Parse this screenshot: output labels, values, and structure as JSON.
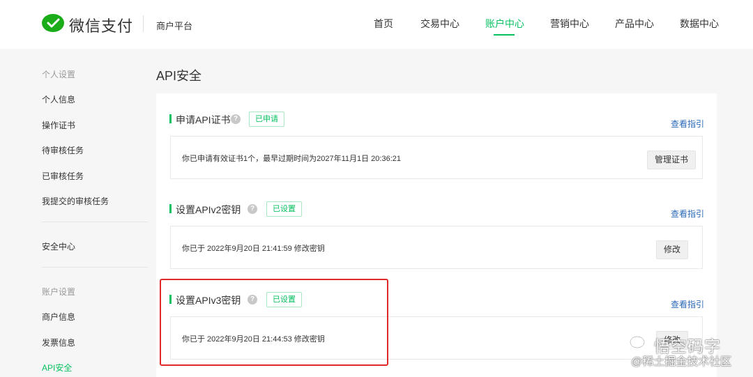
{
  "header": {
    "brand": "微信支付",
    "platform": "商户平台",
    "nav": [
      {
        "label": "首页"
      },
      {
        "label": "交易中心"
      },
      {
        "label": "账户中心"
      },
      {
        "label": "营销中心"
      },
      {
        "label": "产品中心"
      },
      {
        "label": "数据中心"
      }
    ],
    "active_nav": "账户中心",
    "accent_color": "#07c160"
  },
  "sidebar": {
    "group1_title": "个人设置",
    "group1_items": [
      {
        "label": "个人信息"
      },
      {
        "label": "操作证书"
      },
      {
        "label": "待审核任务"
      },
      {
        "label": "已审核任务"
      },
      {
        "label": "我提交的审核任务"
      }
    ],
    "security_center": "安全中心",
    "group2_title": "账户设置",
    "group2_items": [
      {
        "label": "商户信息"
      },
      {
        "label": "发票信息"
      },
      {
        "label": "API安全"
      }
    ],
    "active_item": "API安全"
  },
  "main": {
    "title": "API安全",
    "sections": [
      {
        "title": "申请API证书",
        "badge": "已申请",
        "guide": "查看指引",
        "info": "你已申请有效证书1个，最早过期时间为2027年11月1日 20:36:21",
        "button": "管理证书"
      },
      {
        "title": "设置APIv2密钥",
        "badge": "已设置",
        "guide": "查看指引",
        "info": "你已于 2022年9月20日 21:41:59 修改密钥",
        "button": "修改"
      },
      {
        "title": "设置APIv3密钥",
        "badge": "已设置",
        "guide": "查看指引",
        "info": "你已于 2022年9月20日 21:44:53 修改密钥",
        "button": "修改"
      }
    ],
    "help_glyph": "?"
  },
  "watermark": {
    "line1": "悟空码字",
    "line2": "@稀土掘金技术社区"
  },
  "colors": {
    "link": "#2a69b8",
    "highlight": "#e02a2a"
  }
}
